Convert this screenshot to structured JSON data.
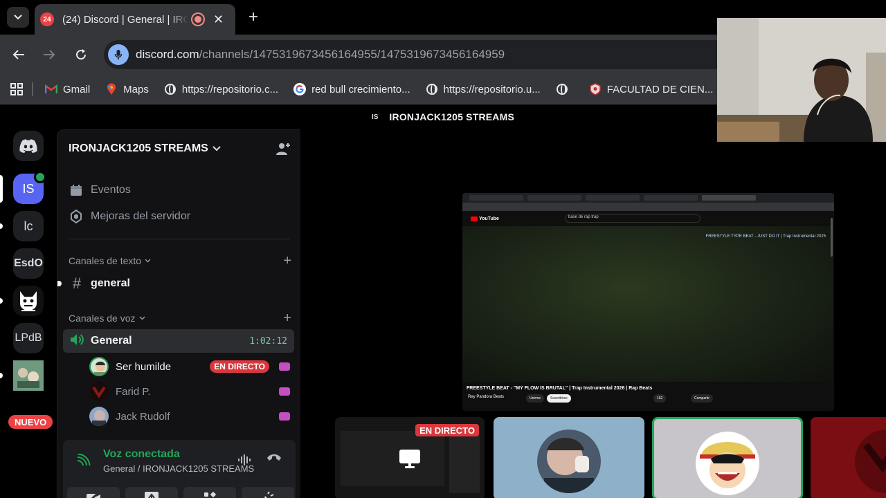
{
  "browser": {
    "tab": {
      "badge": "24",
      "title": "(24) Discord | General | IRONJACK1205 STREAMS"
    },
    "url": {
      "host": "discord.com",
      "path": "/channels/1475319673456164955/1475319673456164959"
    },
    "bookmarks": [
      {
        "label": "Gmail",
        "icon": "gmail-icon"
      },
      {
        "label": "Maps",
        "icon": "maps-icon"
      },
      {
        "label": "https://repositorio.c...",
        "icon": "globe-icon"
      },
      {
        "label": "red bull crecimiento...",
        "icon": "google-icon"
      },
      {
        "label": "https://repositorio.u...",
        "icon": "globe-icon"
      },
      {
        "label": "",
        "icon": "globe-icon"
      },
      {
        "label": "FACULTAD DE CIEN...",
        "icon": "university-icon"
      }
    ]
  },
  "discord": {
    "title_bar": {
      "initials": "IS",
      "server_name": "IRONJACK1205 STREAMS"
    },
    "guilds": [
      {
        "label": "",
        "icon": "discord-home-icon"
      },
      {
        "label": "IS"
      },
      {
        "label": "lc"
      },
      {
        "label": "EsdO"
      },
      {
        "label": "",
        "icon": "mascot-icon",
        "caption": "MASCOT"
      },
      {
        "label": "LPdB"
      },
      {
        "label": "",
        "icon": "server-image"
      }
    ],
    "new_badge": "NUEVO",
    "server": {
      "name": "IRONJACK1205 STREAMS",
      "menu": [
        {
          "label": "Eventos",
          "icon": "calendar-icon"
        },
        {
          "label": "Mejoras del servidor",
          "icon": "boost-icon"
        }
      ],
      "text_category": "Canales de texto",
      "text_channels": [
        {
          "name": "general"
        }
      ],
      "voice_category": "Canales de voz",
      "voice_channel": {
        "name": "General",
        "timer": "1:02:12"
      },
      "voice_users": [
        {
          "name": "Ser humilde",
          "live": "EN DIRECTO",
          "active": true
        },
        {
          "name": "Farid P.",
          "active": false
        },
        {
          "name": "Jack Rudolf",
          "active": false
        }
      ]
    },
    "voice_panel": {
      "status": "Voz conectada",
      "subtitle": "General / IRONJACK1205 STREAMS"
    },
    "screen_share": {
      "search": "base de rap trap",
      "now_playing": "FREESTYLE TYPE BEAT - JUST DO IT | Trap Instrumental 2025",
      "video_title": "FREESTYLE BEAT - \"MY FLOW IS BRUTAL\" | Trap Instrumental 2026 | Rap Beats",
      "channel": "Rey Pandora Beats",
      "buttons": [
        "Unirme",
        "Suscribirse",
        "162",
        "Compartir"
      ]
    },
    "tiles": [
      {
        "live": "EN DIRECTO"
      }
    ]
  },
  "colors": {
    "discord_blurple": "#5865f2",
    "live_red": "#da373c",
    "voice_green": "#23a55a"
  }
}
